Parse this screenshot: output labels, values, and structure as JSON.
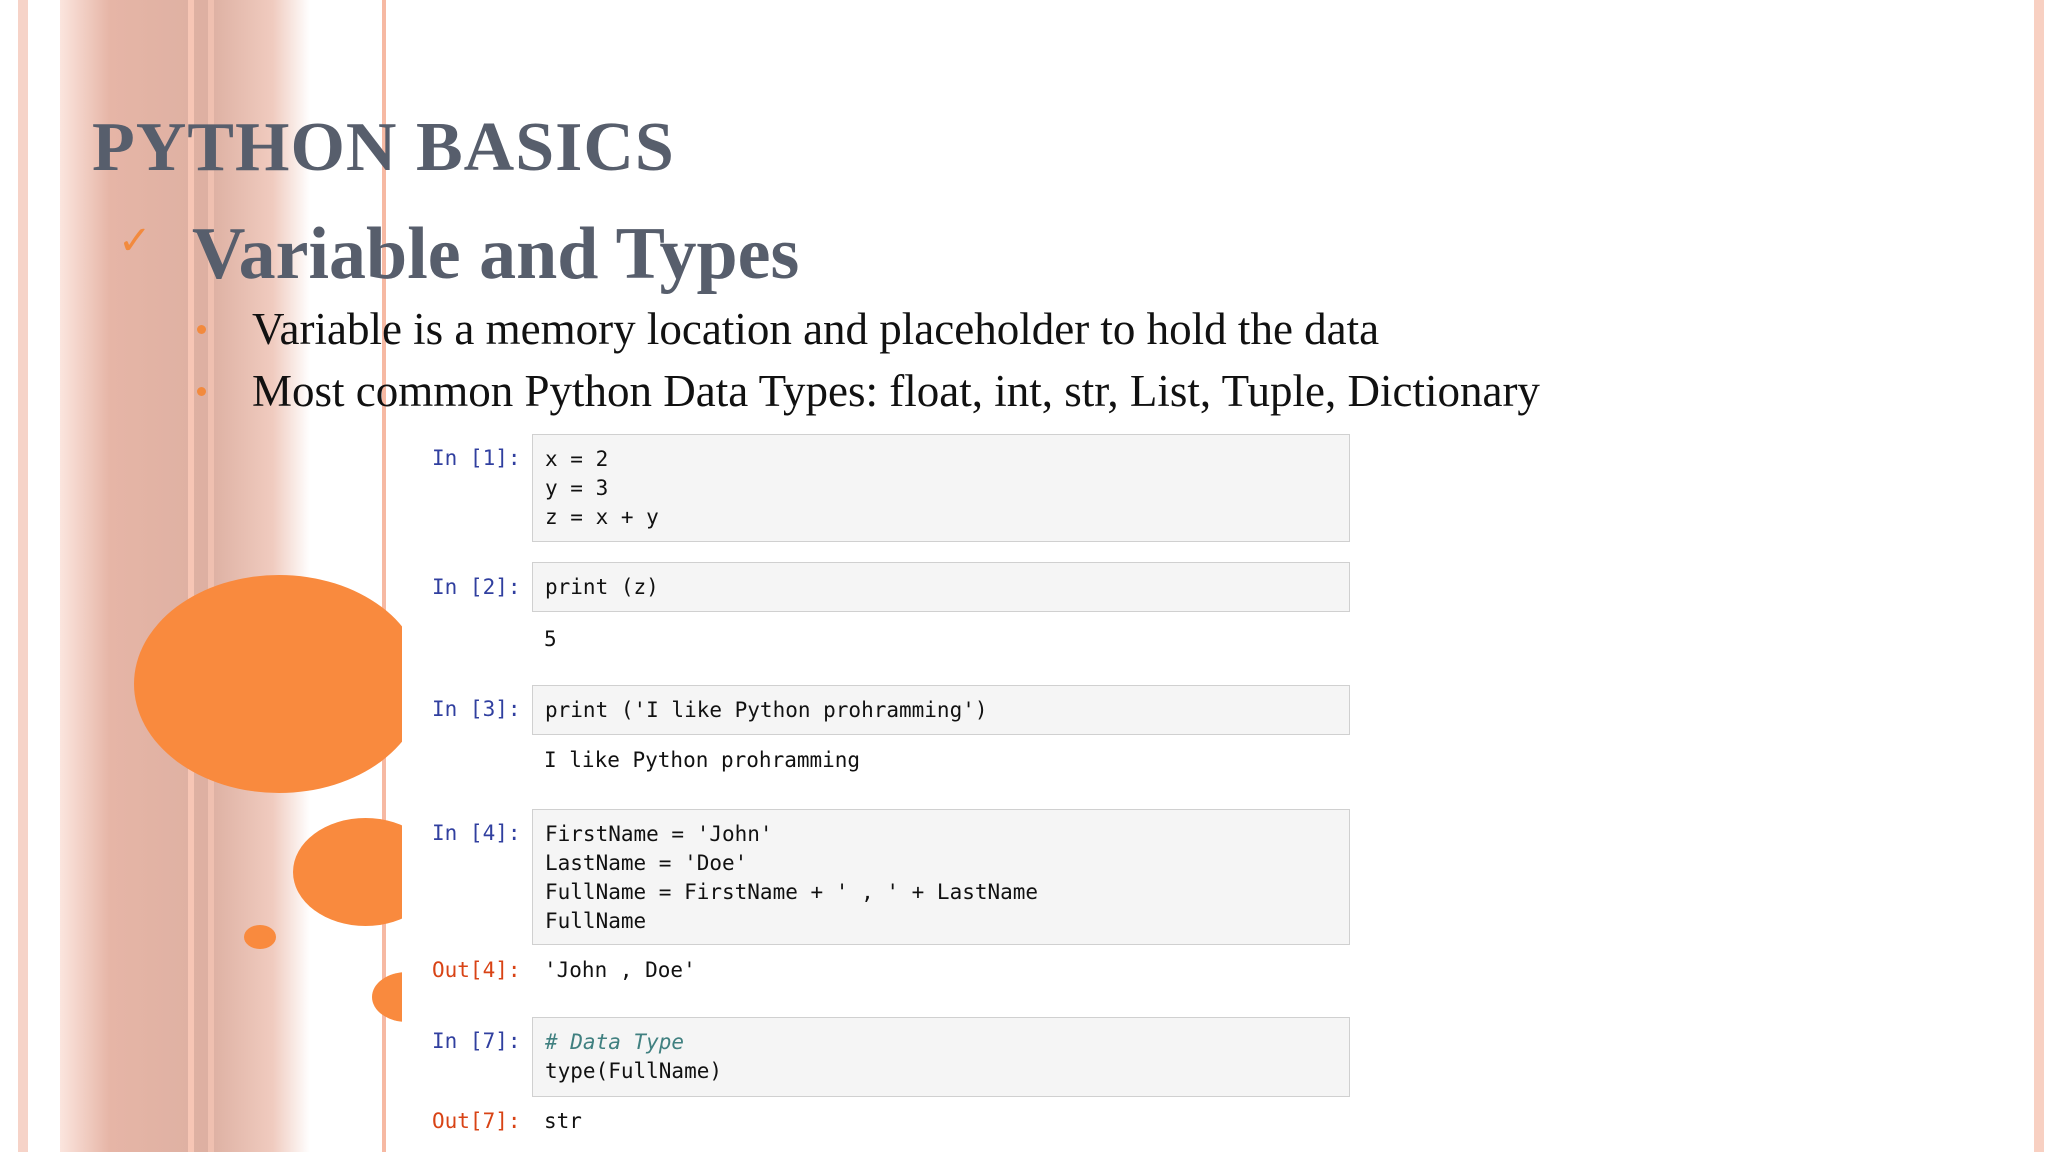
{
  "slide": {
    "title": "PYTHON BASICS",
    "subtitle": "Variable and Types",
    "check_icon": "✓",
    "bullets": [
      "Variable is a memory location and placeholder to hold the data",
      "Most common Python Data Types: float, int, str, List, Tuple, Dictionary"
    ],
    "colors": {
      "accent": "#f98a3e",
      "title": "#575e6c",
      "stripe": "#e8c0b4"
    }
  },
  "notebook": {
    "cells": [
      {
        "prompt": "In [1]:",
        "lines": [
          "x = 2",
          "y = 3",
          "z = x + y"
        ]
      },
      {
        "prompt": "In [2]:",
        "lines": [
          "print (z)"
        ],
        "output": "5"
      },
      {
        "prompt": "In [3]:",
        "lines": [
          "print ('I like Python prohramming')"
        ],
        "output": "I like Python prohramming"
      },
      {
        "prompt": "In [4]:",
        "lines": [
          "FirstName = 'John'",
          "LastName = 'Doe'",
          "FullName = FirstName + ' , ' + LastName",
          "FullName"
        ],
        "out_prompt": "Out[4]:",
        "output": "'John , Doe'"
      },
      {
        "prompt": "In [7]:",
        "lines": [
          "# Data Type",
          "type(FullName)"
        ],
        "out_prompt": "Out[7]:",
        "output": "str"
      }
    ]
  }
}
